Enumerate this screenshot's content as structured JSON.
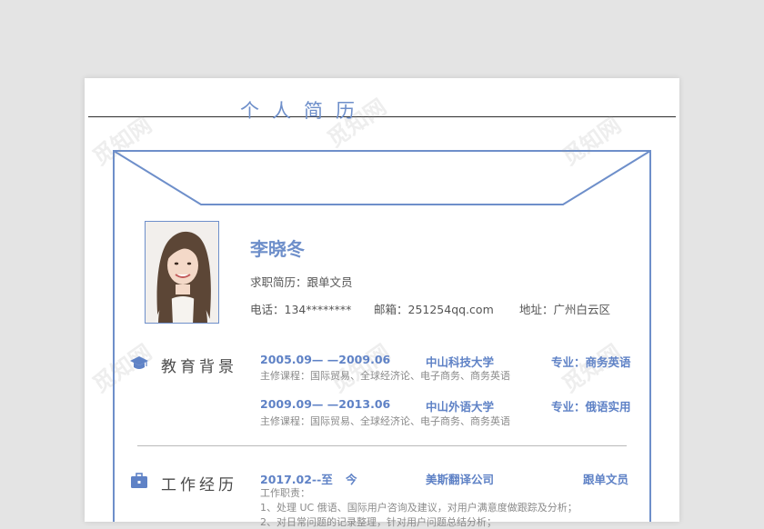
{
  "resume": {
    "title": "个人简历",
    "name": "李晓冬",
    "objective": "求职简历：跟单文员",
    "phone": "电话：134********",
    "email": "邮箱：251254qq.com",
    "address": "地址：广州白云区"
  },
  "education": {
    "heading": "教育背景",
    "icon": "graduation-cap-icon",
    "entries": [
      {
        "period": "2005.09— —2009.06",
        "school": "中山科技大学",
        "major": "专业：商务英语",
        "courses": "主修课程：国际贸易、全球经济论、电子商务、商务英语"
      },
      {
        "period": "2009.09— —2013.06",
        "school": "中山外语大学",
        "major": "专业：俄语实用",
        "courses": "主修课程：国际贸易、全球经济论、电子商务、商务英语"
      }
    ]
  },
  "work": {
    "heading": "工作经历",
    "icon": "briefcase-icon",
    "entries": [
      {
        "period": "2017.02--至",
        "period_end": "今",
        "company": "美斯翻译公司",
        "position": "跟单文员",
        "duties_label": "工作职责：",
        "duties": [
          "1、处理 UC 俄语、国际用户咨询及建议，对用户满意度做跟踪及分析；",
          "2、对日常问题的记录整理，针对用户问题总结分析；"
        ]
      }
    ]
  },
  "watermark": "觅知网",
  "colors": {
    "accent": "#6e8fca",
    "text": "#555555",
    "muted": "#8a8a8a"
  }
}
